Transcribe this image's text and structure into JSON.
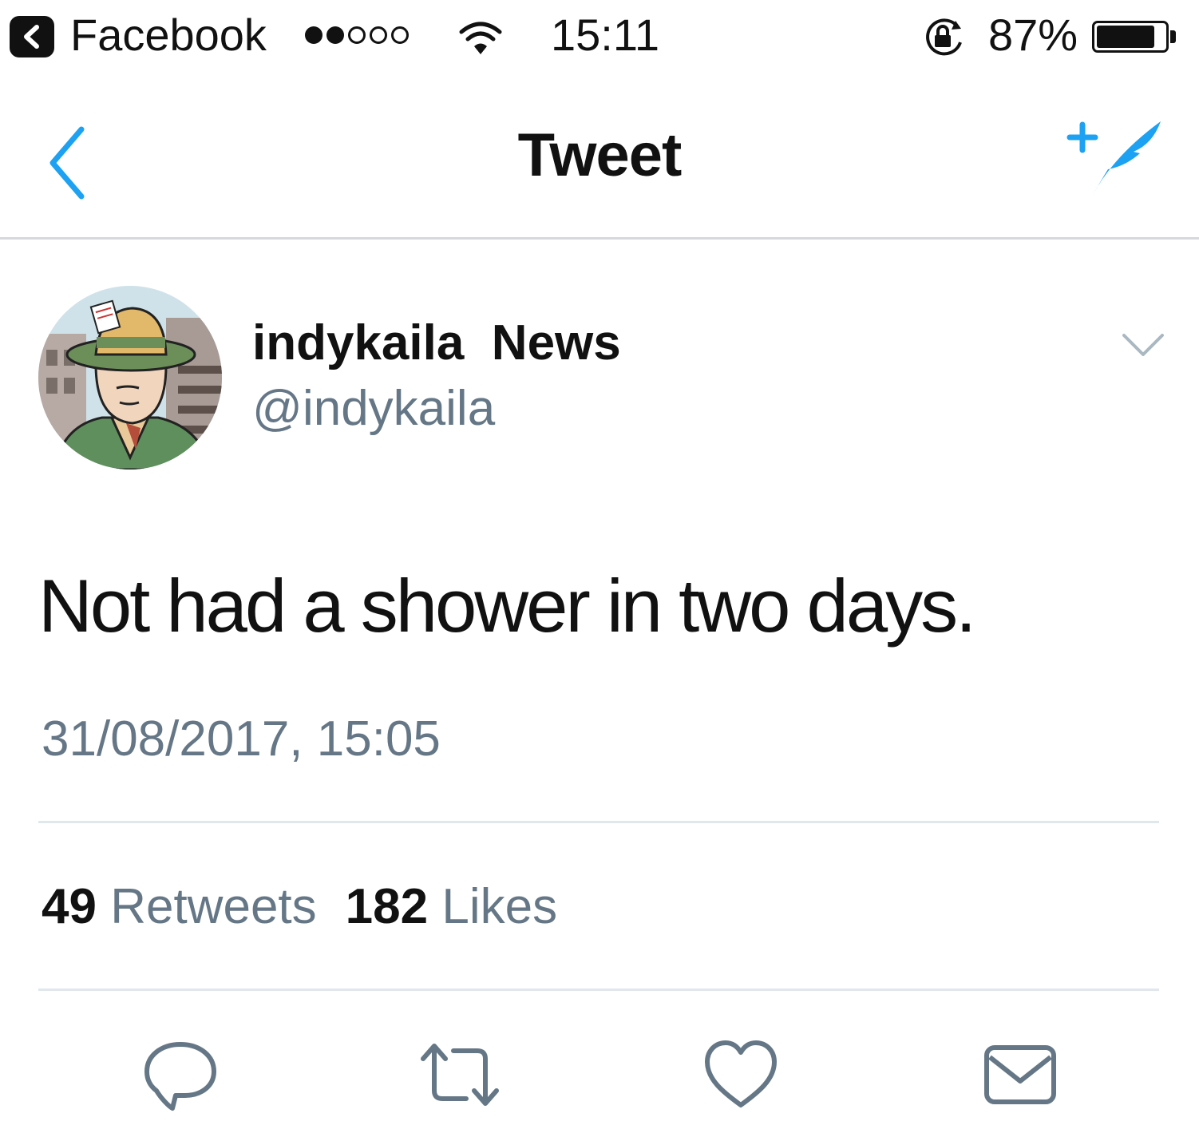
{
  "status_bar": {
    "back_app": "Facebook",
    "time": "15:11",
    "battery_percent": "87%",
    "signal_bars_filled": 2,
    "signal_bars_total": 5,
    "battery_level": 0.87,
    "icons": [
      "back-to-app-icon",
      "wifi-icon",
      "orientation-lock-icon",
      "battery-icon"
    ]
  },
  "nav": {
    "title": "Tweet",
    "back_icon": "chevron-left-icon",
    "compose_icon": "compose-tweet-icon",
    "accent_color": "#1da1f2"
  },
  "tweet": {
    "display_name": "indykaila  News",
    "handle": "@indykaila",
    "text": "Not had a shower in two days.",
    "timestamp": "31/08/2017, 15:05",
    "retweets_count": "49",
    "retweets_label": "Retweets",
    "likes_count": "182",
    "likes_label": "Likes"
  },
  "actions": [
    "reply-icon",
    "retweet-icon",
    "like-icon",
    "direct-message-icon"
  ],
  "colors": {
    "secondary_text": "#657786",
    "divider": "#e1e8ed",
    "action_icon": "#657786"
  }
}
